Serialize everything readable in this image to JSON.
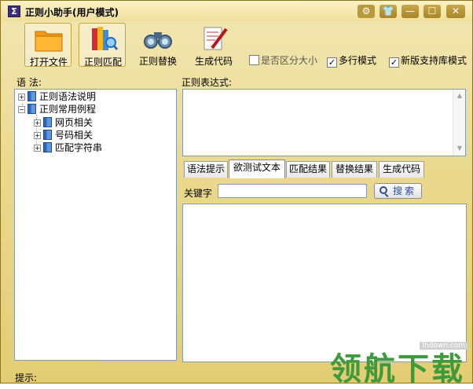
{
  "window": {
    "title": "正则小助手(用户模式)",
    "app_icon_glyph": "Σ",
    "controls": {
      "settings": "⚙",
      "skin": "👕",
      "minimize": "—",
      "maximize": "☐",
      "close": "✕"
    }
  },
  "toolbar": {
    "open_file": "打开文件",
    "regex_match": "正则匹配",
    "regex_replace": "正则替换",
    "generate_code": "生成代码",
    "options": [
      {
        "label": "是否区分大小",
        "checked": false
      },
      {
        "label": "多行模式",
        "checked": true
      },
      {
        "label": "新版支持库模式",
        "checked": true
      }
    ]
  },
  "left": {
    "label": "语 法:",
    "tree": [
      {
        "label": "正则语法说明",
        "expander": "+"
      },
      {
        "label": "正则常用例程",
        "expander": "−"
      },
      {
        "label": "网页相关",
        "expander": "+"
      },
      {
        "label": "号码相关",
        "expander": "+"
      },
      {
        "label": "匹配字符串",
        "expander": "+"
      }
    ]
  },
  "right": {
    "regex_label": "正则表达式:",
    "tabs": [
      "语法提示",
      "欲测试文本",
      "匹配结果",
      "替换结果",
      "生成代码"
    ],
    "active_tab": 1,
    "keyword_label": "关键字",
    "keyword_value": "",
    "search_button": "搜索"
  },
  "status": {
    "label": "提示:"
  },
  "watermark": {
    "text": "领航下载",
    "url": "lhdown.com"
  },
  "colors": {
    "frame": "#e3cd74",
    "accent_blue": "#2a4f9a",
    "watermark_green": "#3e9a3a"
  }
}
